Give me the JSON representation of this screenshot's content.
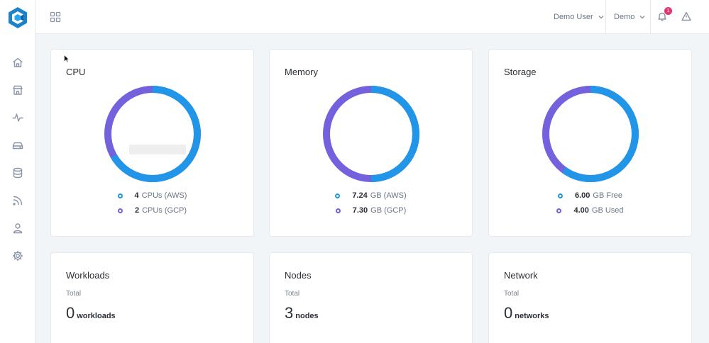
{
  "topbar": {
    "user_label": "Demo User",
    "project_label": "Demo",
    "notification_count": "1"
  },
  "sidebar": {
    "items": [
      {
        "icon": "home-icon"
      },
      {
        "icon": "store-icon"
      },
      {
        "icon": "activity-icon"
      },
      {
        "icon": "drive-icon"
      },
      {
        "icon": "database-icon"
      },
      {
        "icon": "rss-icon"
      },
      {
        "icon": "user-icon"
      },
      {
        "icon": "settings-icon"
      }
    ]
  },
  "colors": {
    "primary": "#2196e9",
    "secondary": "#7361de"
  },
  "cards": {
    "cpu": {
      "title": "CPU",
      "legend": [
        {
          "value": "4",
          "label": "CPUs (AWS)"
        },
        {
          "value": "2",
          "label": "CPUs (GCP)"
        }
      ]
    },
    "memory": {
      "title": "Memory",
      "legend": [
        {
          "value": "7.24",
          "label": "GB (AWS)"
        },
        {
          "value": "7.30",
          "label": "GB (GCP)"
        }
      ]
    },
    "storage": {
      "title": "Storage",
      "legend": [
        {
          "value": "6.00",
          "label": "GB Free"
        },
        {
          "value": "4.00",
          "label": "GB Used"
        }
      ]
    },
    "workloads": {
      "title": "Workloads",
      "sub": "Total",
      "value": "0",
      "unit": "workloads"
    },
    "nodes": {
      "title": "Nodes",
      "sub": "Total",
      "value": "3",
      "unit": "nodes"
    },
    "network": {
      "title": "Network",
      "sub": "Total",
      "value": "0",
      "unit": "networks"
    }
  }
}
